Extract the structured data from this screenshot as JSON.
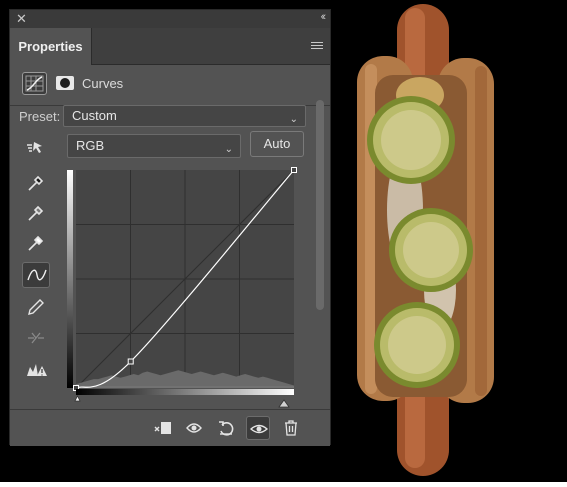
{
  "panel": {
    "tab_label": "Properties",
    "adjustment_title": "Curves",
    "preset_label": "Preset:",
    "preset_value": "Custom",
    "channel_value": "RGB",
    "auto_label": "Auto"
  },
  "curve": {
    "points": [
      [
        0,
        0
      ],
      [
        64,
        31
      ],
      [
        255,
        255
      ]
    ],
    "input_black": 0,
    "input_white": 255
  },
  "histogram": [
    3,
    4,
    5,
    6,
    7,
    7,
    8,
    9,
    10,
    9,
    8,
    9,
    10,
    11,
    10,
    12,
    13,
    12,
    11,
    10,
    11,
    12,
    13,
    14,
    13,
    12,
    11,
    12,
    13,
    12,
    11,
    10,
    11,
    12,
    11,
    10,
    9,
    10,
    11,
    10,
    9,
    8,
    9,
    8,
    7,
    6,
    5,
    4,
    3,
    2
  ],
  "colors": {
    "panel_bg": "#535353",
    "graph_bg": "#454545",
    "canvas_bg": "#000000"
  },
  "icons": {
    "close": "close-icon",
    "collapse": "double-chevron-icon",
    "menu": "panel-menu-icon",
    "adjustment": "curves-adjustment-icon",
    "mask": "layer-mask-icon",
    "target": "on-image-adjust-icon",
    "eyedropper_black": "eyedropper-black-icon",
    "eyedropper_gray": "eyedropper-gray-icon",
    "eyedropper_white": "eyedropper-white-icon",
    "curve_tool": "curve-points-icon",
    "pencil": "pencil-draw-icon",
    "smooth": "smooth-curve-icon",
    "clipping": "clipping-warning-icon",
    "clip_layer": "clip-to-layer-icon",
    "view_previous": "view-previous-icon",
    "reset": "reset-icon",
    "visibility": "visibility-eye-icon",
    "delete": "trash-icon"
  }
}
